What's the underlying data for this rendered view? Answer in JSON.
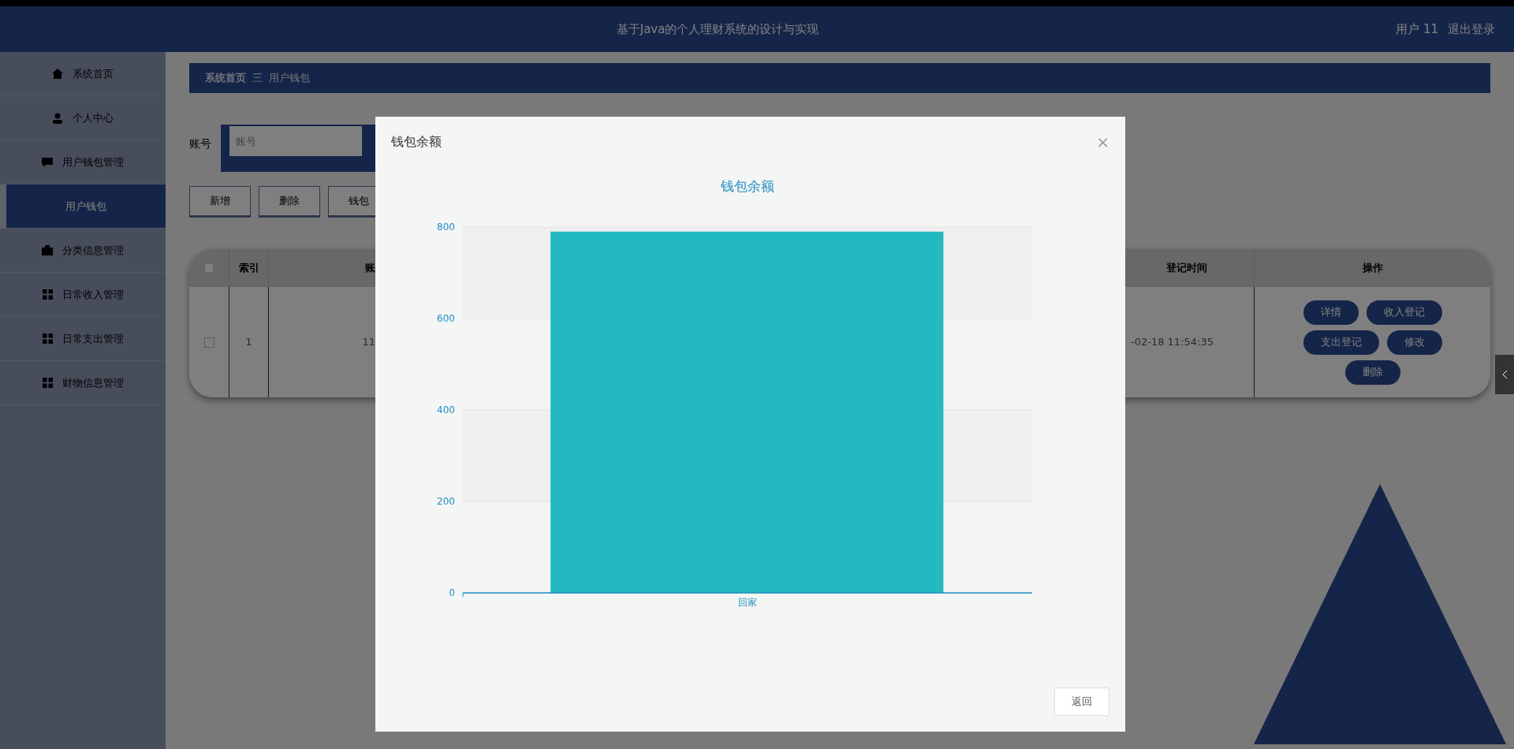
{
  "header": {
    "title": "基于Java的个人理财系统的设计与实现",
    "user": "用户 11",
    "logout": "退出登录"
  },
  "sidebar": {
    "items": [
      {
        "label": "系统首页",
        "kind": "home",
        "selected": false
      },
      {
        "label": "个人中心",
        "kind": "user",
        "selected": false
      },
      {
        "label": "用户钱包管理",
        "kind": "chat",
        "selected": false
      },
      {
        "label": "用户钱包",
        "kind": "sub",
        "selected": true
      },
      {
        "label": "分类信息管理",
        "kind": "briefcase",
        "selected": false
      },
      {
        "label": "日常收入管理",
        "kind": "grid",
        "selected": false
      },
      {
        "label": "日常支出管理",
        "kind": "grid",
        "selected": false
      },
      {
        "label": "财物信息管理",
        "kind": "grid",
        "selected": false
      }
    ]
  },
  "breadcrumb": {
    "home": "系统首页",
    "separator": "三",
    "current": "用户钱包"
  },
  "search": {
    "label": "账号",
    "placeholder": "账号"
  },
  "toolbar": [
    "新增",
    "删除",
    "钱包"
  ],
  "table": {
    "all_checked": false,
    "columns": {
      "index": "索引",
      "account": "账",
      "time": "登记时间",
      "actions": "操作"
    },
    "rows": [
      {
        "checked": false,
        "index": "1",
        "account": "11",
        "time": "-02-18 11:54:35",
        "actions": [
          "详情",
          "收入登记",
          "支出登记",
          "修改",
          "删除"
        ]
      }
    ]
  },
  "modal": {
    "title": "钱包余额",
    "close": "×",
    "back": "返回",
    "chart_data": {
      "type": "bar",
      "title": "钱包余额",
      "categories": [
        "回家"
      ],
      "values": [
        790
      ],
      "grid": true,
      "ylim": [
        0,
        800
      ],
      "yticks": [
        0,
        200,
        400,
        600,
        800
      ]
    }
  }
}
